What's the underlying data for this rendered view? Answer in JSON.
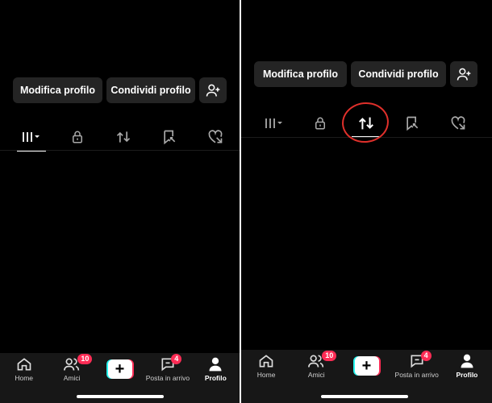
{
  "left": {
    "buttons": {
      "edit_profile": "Modifica profilo",
      "share_profile": "Condividi profilo"
    },
    "tabs": [
      {
        "icon": "grid-icon",
        "active": true
      },
      {
        "icon": "lock-icon",
        "active": false
      },
      {
        "icon": "repost-icon",
        "active": false
      },
      {
        "icon": "bookmark-icon",
        "active": false
      },
      {
        "icon": "liked-heart-icon",
        "active": false
      }
    ],
    "nav": {
      "home": "Home",
      "friends": "Amici",
      "friends_badge": "10",
      "inbox": "Posta in arrivo",
      "inbox_badge": "4",
      "profile": "Profilo",
      "create": "+"
    }
  },
  "right": {
    "buttons": {
      "edit_profile": "Modifica profilo",
      "share_profile": "Condividi profilo"
    },
    "tabs": [
      {
        "icon": "grid-icon",
        "active": false
      },
      {
        "icon": "lock-icon",
        "active": false
      },
      {
        "icon": "repost-icon",
        "active": true
      },
      {
        "icon": "bookmark-icon",
        "active": false
      },
      {
        "icon": "liked-heart-icon",
        "active": false
      }
    ],
    "nav": {
      "home": "Home",
      "friends": "Amici",
      "friends_badge": "10",
      "inbox": "Posta in arrivo",
      "inbox_badge": "4",
      "profile": "Profilo",
      "create": "+"
    }
  },
  "colors": {
    "background": "#000000",
    "button": "#242424",
    "accent_red": "#fe2c55",
    "accent_cyan": "#25f4ee",
    "annotation": "#e0302b"
  }
}
